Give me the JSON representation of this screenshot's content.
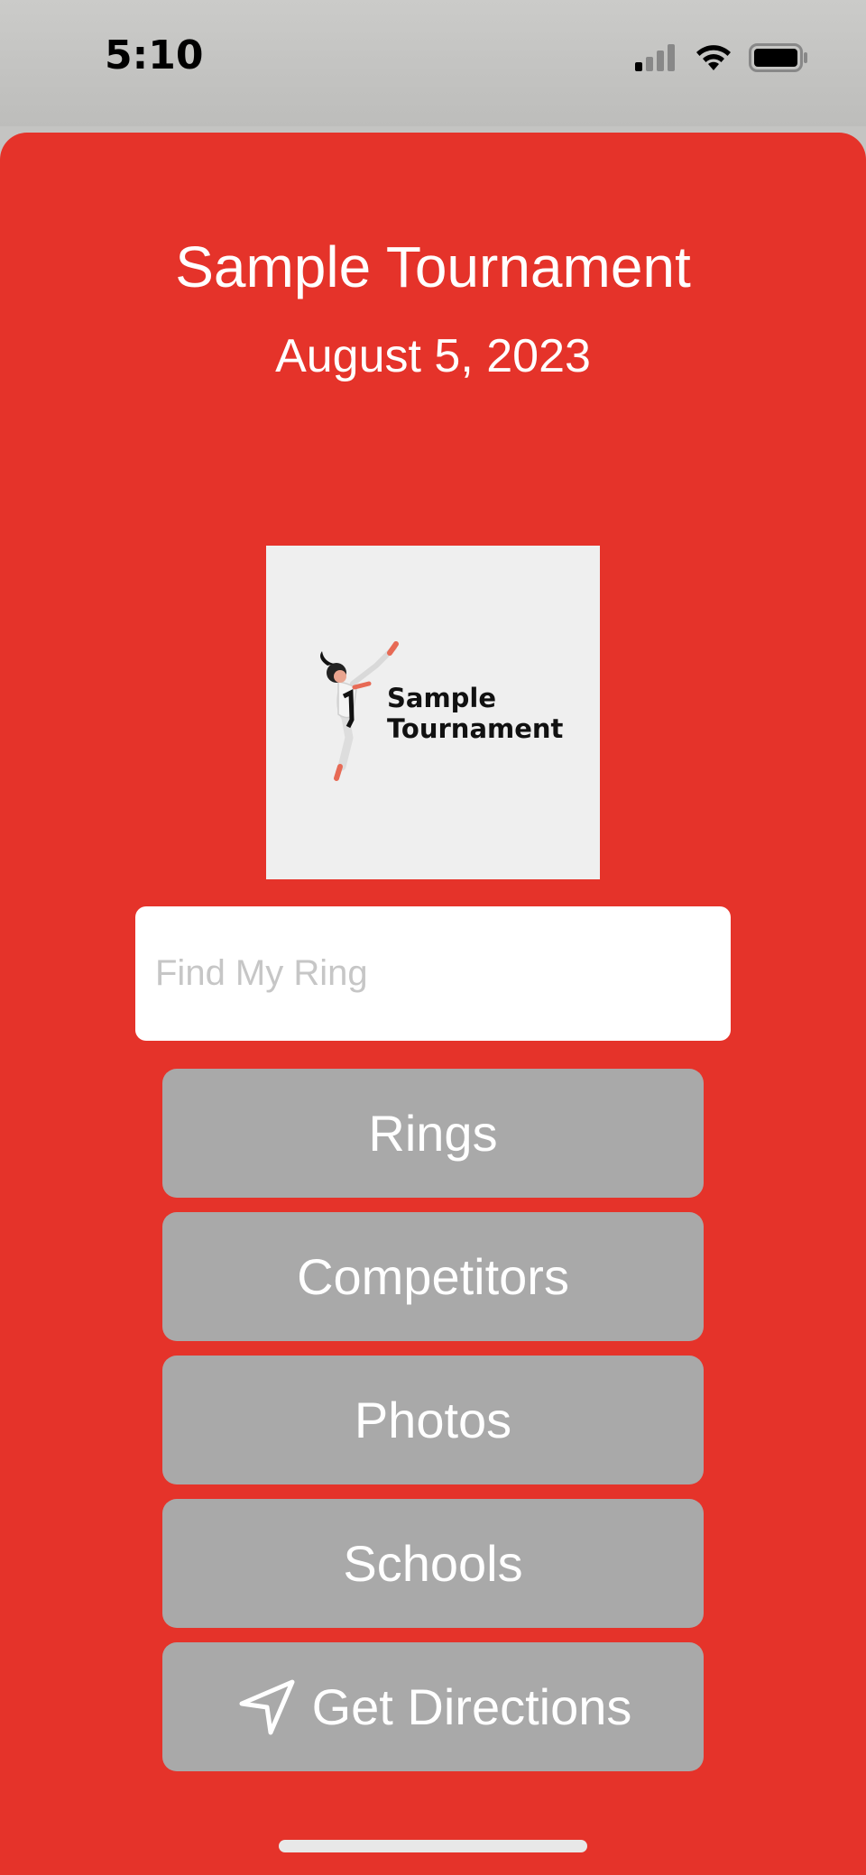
{
  "status_bar": {
    "time": "5:10",
    "signal_icon": "cellular-signal-icon",
    "wifi_icon": "wifi-icon",
    "battery_icon": "battery-icon"
  },
  "header": {
    "title": "Sample Tournament",
    "date": "August 5, 2023"
  },
  "logo": {
    "text_line1": "Sample",
    "text_line2": "Tournament",
    "icon": "karate-kick-figure"
  },
  "search": {
    "placeholder": "Find My Ring",
    "value": ""
  },
  "buttons": {
    "rings": "Rings",
    "competitors": "Competitors",
    "photos": "Photos",
    "schools": "Schools",
    "directions": "Get Directions",
    "directions_icon": "location-arrow-icon"
  },
  "colors": {
    "accent": "#e5332a",
    "button": "#a9a9a9",
    "text": "#ffffff"
  }
}
